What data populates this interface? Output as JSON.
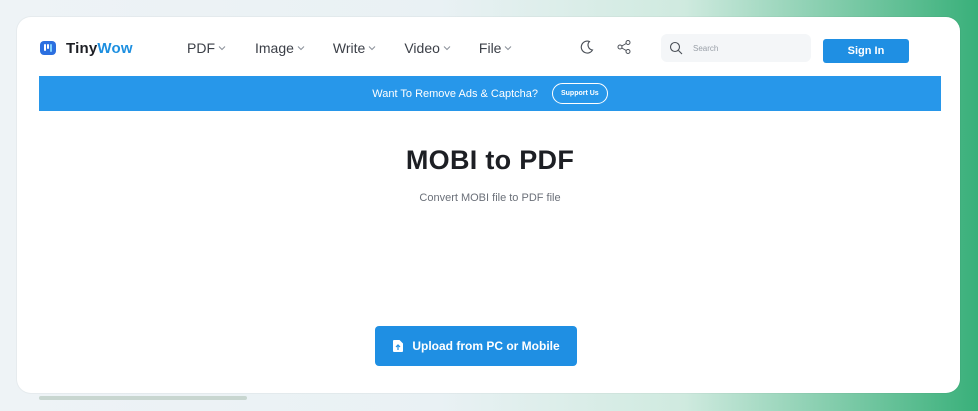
{
  "brand": {
    "name_main": "Tiny",
    "name_accent": "Wow"
  },
  "nav": {
    "items": [
      {
        "label": "PDF"
      },
      {
        "label": "Image"
      },
      {
        "label": "Write"
      },
      {
        "label": "Video"
      },
      {
        "label": "File"
      }
    ]
  },
  "search": {
    "placeholder": "Search"
  },
  "auth": {
    "signin_label": "Sign In"
  },
  "banner": {
    "text": "Want To Remove Ads & Captcha?",
    "button_label": "Support Us"
  },
  "main": {
    "title": "MOBI to PDF",
    "subtitle": "Convert MOBI file to PDF file",
    "upload_label": "Upload from PC or Mobile"
  },
  "colors": {
    "primary": "#1f8fe3",
    "banner": "#2797ea",
    "accent_green": "#39b07a"
  },
  "icons": [
    "logo-icon",
    "chevron-down-icon",
    "moon-icon",
    "share-icon",
    "search-icon",
    "file-upload-icon"
  ]
}
